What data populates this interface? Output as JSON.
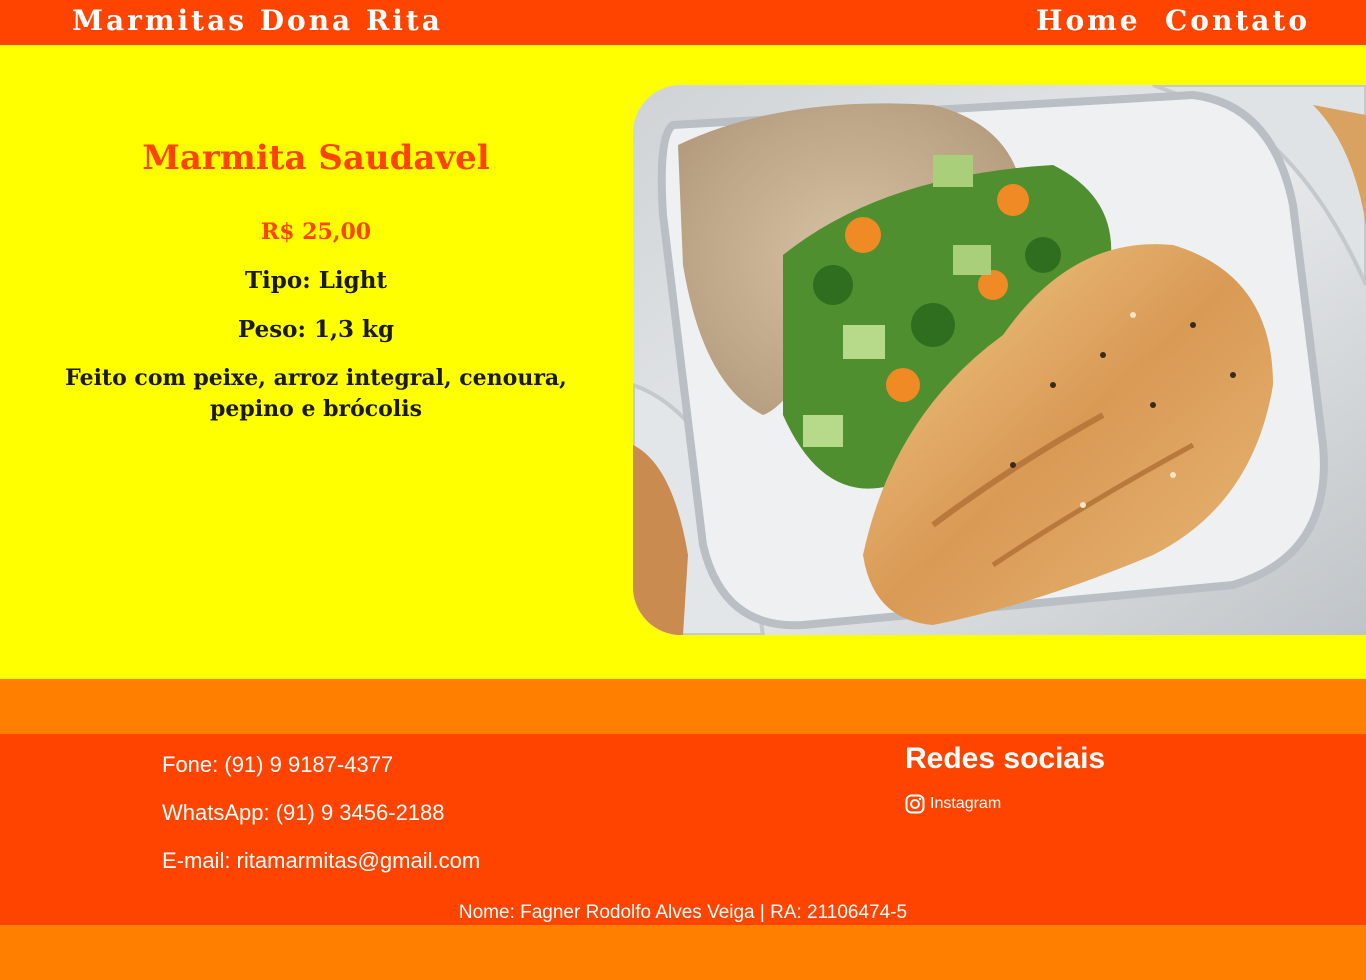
{
  "header": {
    "site_title": "Marmitas Dona Rita",
    "nav": [
      {
        "label": "Home"
      },
      {
        "label": "Contato"
      }
    ]
  },
  "product": {
    "name": "Marmita Saudavel",
    "price": "R$ 25,00",
    "type": "Tipo: Light",
    "weight": "Peso: 1,3 kg",
    "description": "Feito com peixe, arroz integral, cenoura, pepino e brócolis",
    "image_icon": "food-photo"
  },
  "footer": {
    "phone": "Fone: (91) 9 9187-4377",
    "whatsapp": "WhatsApp: (91) 9 3456-2188",
    "email": "E-mail: ritamarmitas@gmail.com",
    "social_heading": "Redes sociais",
    "social_links": [
      {
        "label": "Instagram",
        "icon": "instagram-icon"
      }
    ],
    "credits": "Nome: Fagner Rodolfo Alves Veiga | RA: 21106474-5"
  },
  "colors": {
    "header_bg": "#FF4400",
    "product_bg": "#FFFF00",
    "band_bg": "#FF8000",
    "accent_text": "#FF4400",
    "body_text": "#1A1A1A"
  }
}
